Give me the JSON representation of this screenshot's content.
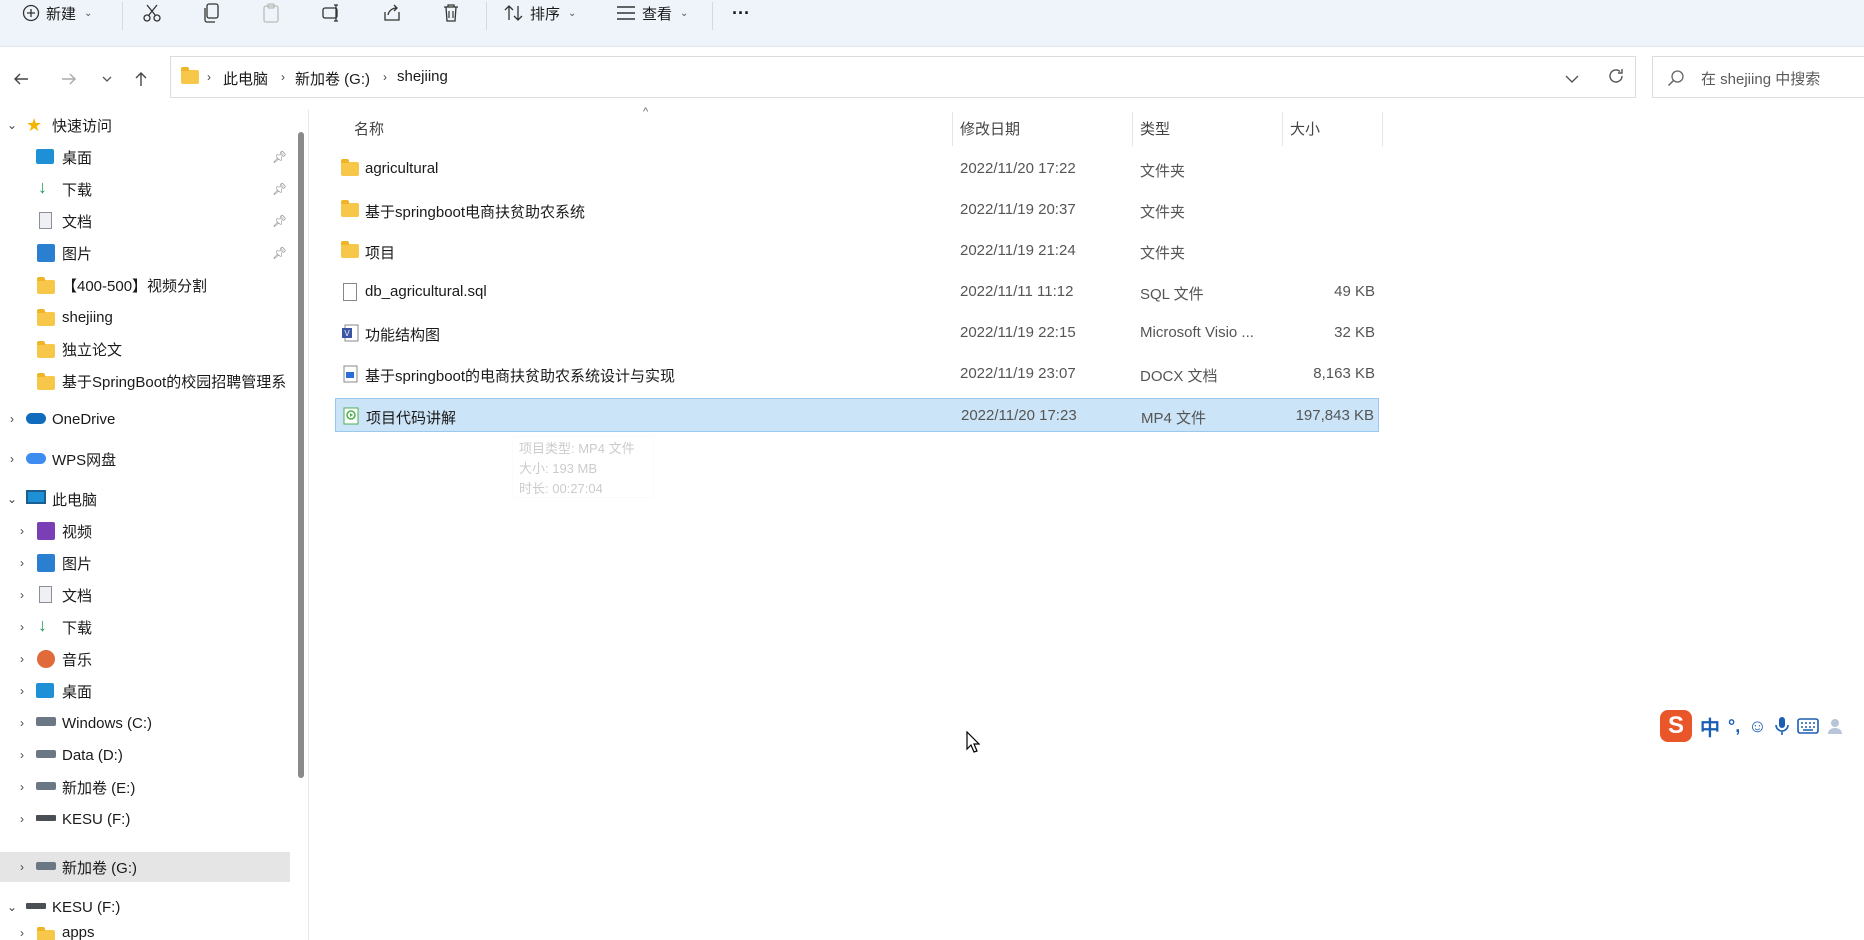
{
  "toolbar": {
    "new_label": "新建",
    "sort_label": "排序",
    "view_label": "查看",
    "more_label": "···"
  },
  "address": {
    "crumbs": [
      "此电脑",
      "新加卷 (G:)",
      "shejiing"
    ]
  },
  "search": {
    "placeholder": "在 shejiing 中搜索"
  },
  "sidebar": {
    "quick_access": "快速访问",
    "quick_items": [
      "桌面",
      "下载",
      "文档",
      "图片",
      "【400-500】视频分割",
      "shejiing",
      "独立论文",
      "基于SpringBoot的校园招聘管理系"
    ],
    "onedrive": "OneDrive",
    "wps": "WPS网盘",
    "this_pc": "此电脑",
    "pc_items": [
      "视频",
      "图片",
      "文档",
      "下载",
      "音乐",
      "桌面",
      "Windows (C:)",
      "Data (D:)",
      "新加卷 (E:)",
      "KESU  (F:)",
      "新加卷 (G:)"
    ],
    "kesu": "KESU  (F:)",
    "apps": "apps"
  },
  "columns": {
    "name": "名称",
    "modified": "修改日期",
    "type": "类型",
    "size": "大小"
  },
  "files": [
    {
      "name": "agricultural",
      "modified": "2022/11/20 17:22",
      "type": "文件夹",
      "size": "",
      "icon": "folder-icon"
    },
    {
      "name": "基于springboot电商扶贫助农系统",
      "modified": "2022/11/19 20:37",
      "type": "文件夹",
      "size": "",
      "icon": "folder-icon"
    },
    {
      "name": "项目",
      "modified": "2022/11/19 21:24",
      "type": "文件夹",
      "size": "",
      "icon": "folder-icon"
    },
    {
      "name": "db_agricultural.sql",
      "modified": "2022/11/11 11:12",
      "type": "SQL 文件",
      "size": "49 KB",
      "icon": "file-icon"
    },
    {
      "name": "功能结构图",
      "modified": "2022/11/19 22:15",
      "type": "Microsoft Visio ...",
      "size": "32 KB",
      "icon": "visio-icon"
    },
    {
      "name": "基于springboot的电商扶贫助农系统设计与实现",
      "modified": "2022/11/19 23:07",
      "type": "DOCX 文档",
      "size": "8,163 KB",
      "icon": "docx-icon"
    },
    {
      "name": "项目代码讲解",
      "modified": "2022/11/20 17:23",
      "type": "MP4 文件",
      "size": "197,843 KB",
      "icon": "video-icon"
    }
  ],
  "tooltip": {
    "type": "项目类型: MP4 文件",
    "size": "大小: 193 MB",
    "duration": "时长: 00:27:04"
  },
  "ime": {
    "label": "中"
  },
  "colors": {
    "toolbar_bg": "#eef4f9",
    "selection": "#cce4f7",
    "folder": "#f7c74a",
    "accent": "#0067c0"
  }
}
